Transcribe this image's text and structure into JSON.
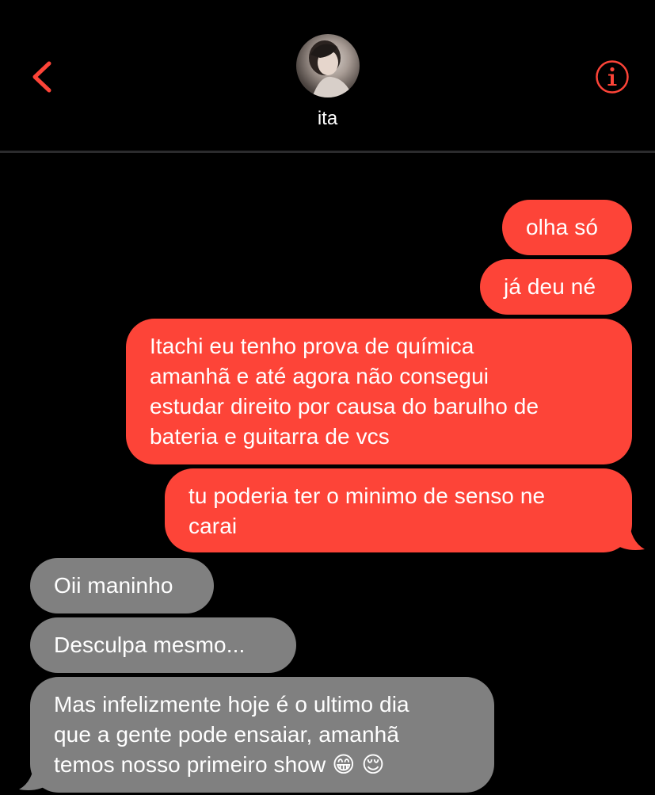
{
  "header": {
    "contact_name": "ita",
    "back_icon": "chevron-left-icon",
    "info_icon": "info-circle-icon",
    "accent_color": "#fd4438"
  },
  "messages": {
    "sent": [
      {
        "text": "olha só"
      },
      {
        "text": "já deu né"
      },
      {
        "text": "Itachi eu tenho prova de química\namanhã e até agora não consegui\nestudar direito por causa do barulho de\nbateria e guitarra de vcs"
      },
      {
        "text": "tu poderia ter o minimo de senso ne\ncarai"
      }
    ],
    "received": [
      {
        "text": "Oii maninho"
      },
      {
        "text": "Desculpa mesmo..."
      },
      {
        "text": "Mas infelizmente hoje é o ultimo dia\nque a gente pode ensaiar, amanhã\ntemos nosso primeiro show 😁 😌"
      }
    ]
  },
  "colors": {
    "sent_bubble": "#fd4438",
    "received_bubble": "#808080",
    "background": "#000000"
  }
}
